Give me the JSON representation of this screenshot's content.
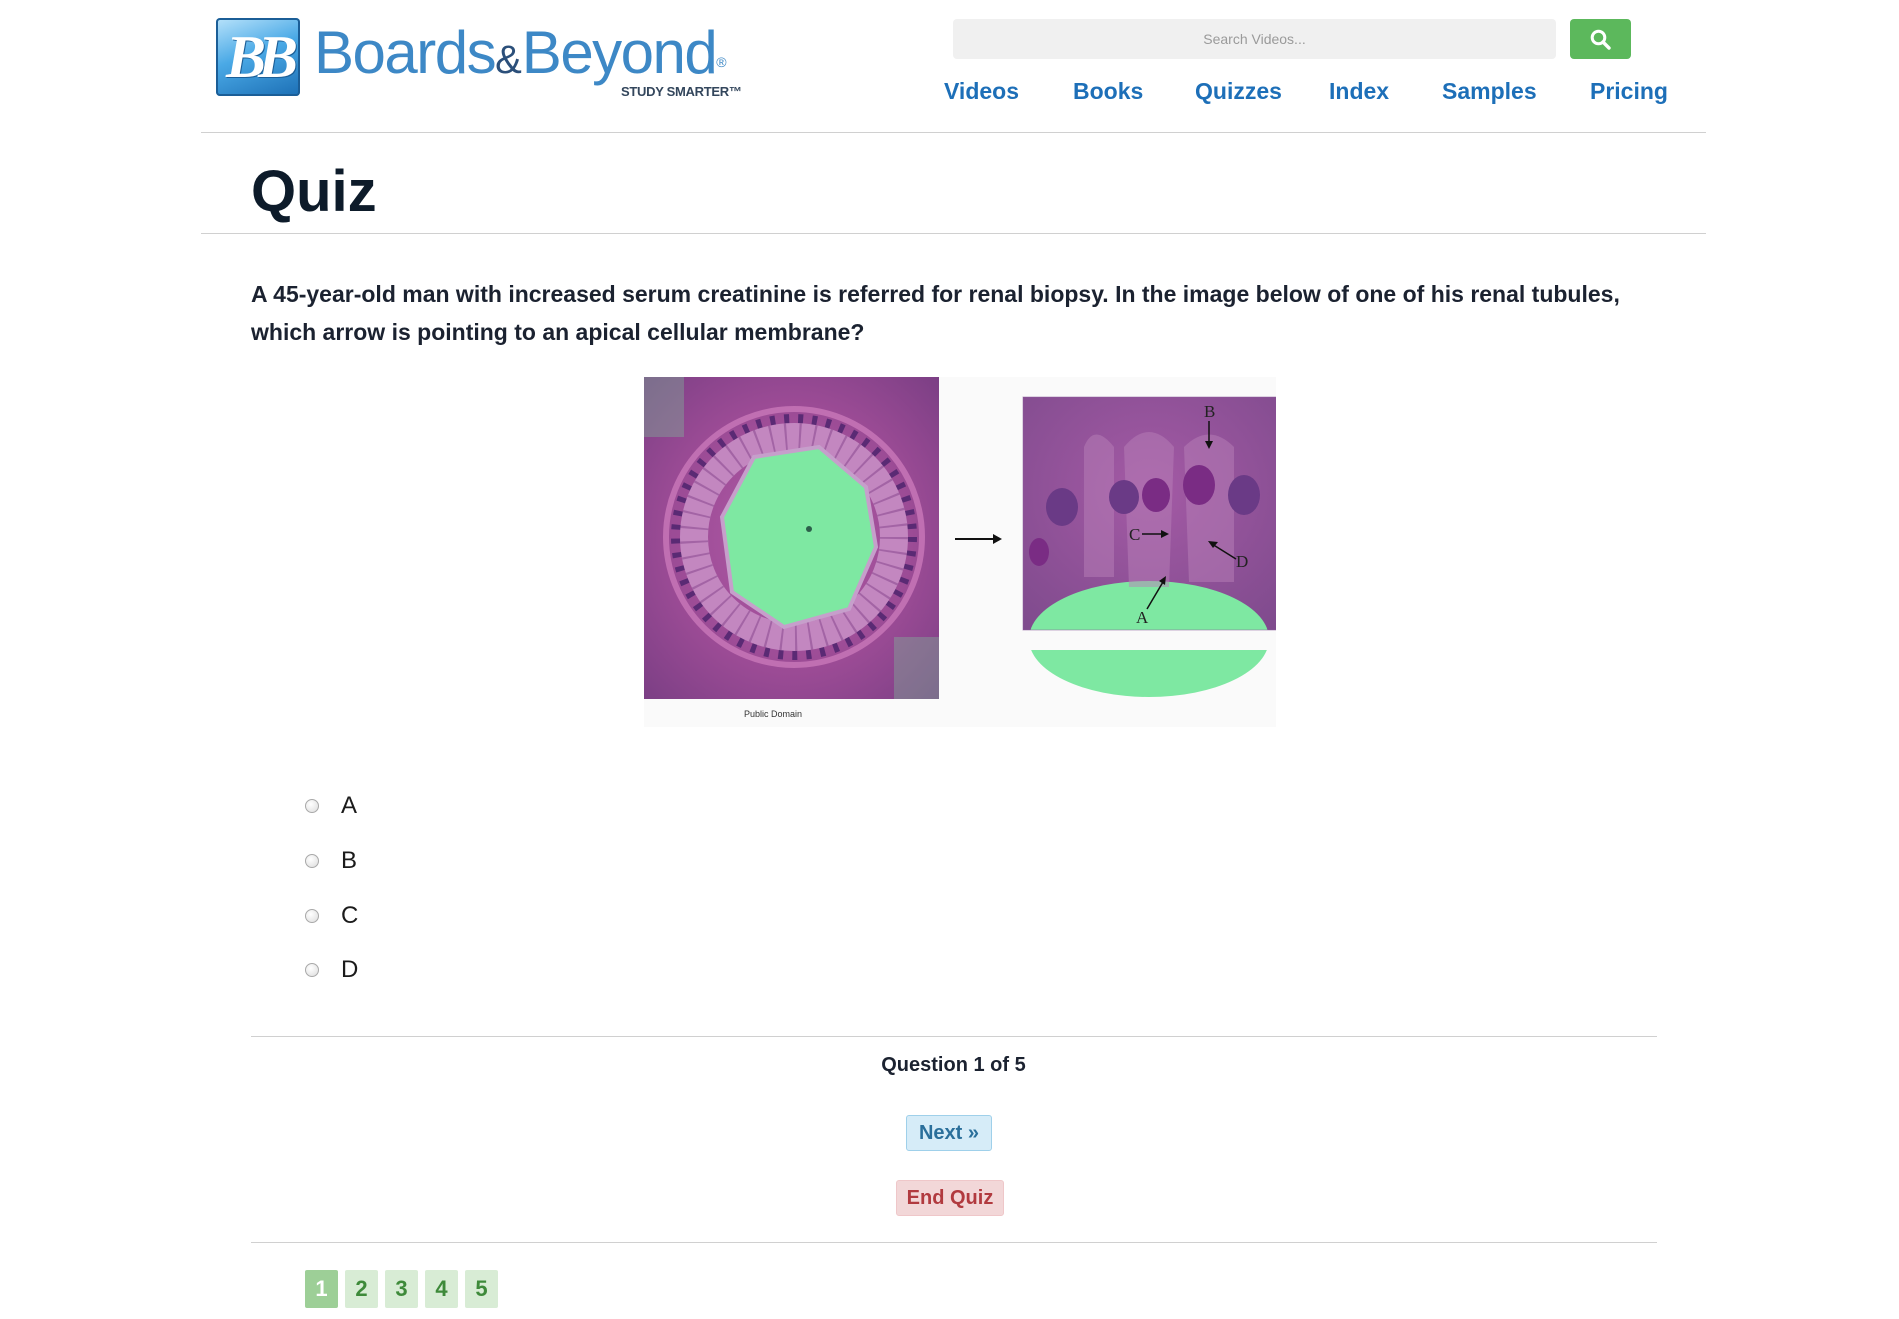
{
  "brand": {
    "badge": "BB",
    "name_left": "Boards",
    "name_amp": "&",
    "name_right": "Beyond",
    "registered": "®",
    "tagline": "STUDY SMARTER™"
  },
  "search": {
    "placeholder": "Search Videos...",
    "button_icon": "search-icon"
  },
  "nav": {
    "items": [
      "Videos",
      "Books",
      "Quizzes",
      "Index",
      "Samples",
      "Pricing"
    ]
  },
  "page": {
    "title": "Quiz"
  },
  "question": {
    "text": "A 45-year-old man with increased serum creatinine is referred for renal biopsy. In the image below of one of his renal tubules, which arrow is pointing to an apical cellular membrane?",
    "image": {
      "credit": "Public Domain",
      "arrow_labels": [
        "A",
        "B",
        "C",
        "D"
      ]
    },
    "options": [
      "A",
      "B",
      "C",
      "D"
    ]
  },
  "progress": {
    "label": "Question",
    "current": "1",
    "of_label": "of",
    "total": "5"
  },
  "buttons": {
    "next": "Next »",
    "end": "End Quiz"
  },
  "pagination": {
    "pages": [
      "1",
      "2",
      "3",
      "4",
      "5"
    ],
    "active": "1"
  },
  "colors": {
    "nav_link": "#1d6fb8",
    "search_button": "#5cb85c",
    "next_bg": "#d6ecf8",
    "end_bg": "#f2d7d8",
    "page_bg": "#d8ecd5",
    "page_active_bg": "#9dcf97"
  }
}
